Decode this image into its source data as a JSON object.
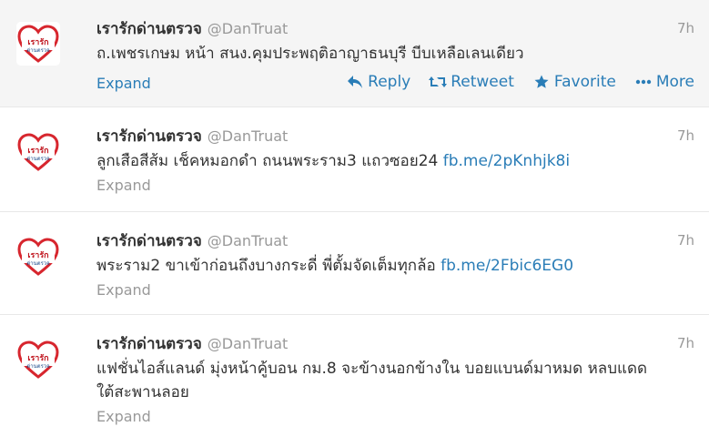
{
  "tweets": [
    {
      "name": "เรารักด่านตรวจ",
      "handle": "@DanTruat",
      "time": "7h",
      "text": "ถ.เพชรเกษม หน้า สนง.คุมประพฤติอาญาธนบุรี บีบเหลือเลนเดียว",
      "link": "",
      "expand": "Expand",
      "actions": [
        "Reply",
        "Retweet",
        "Favorite",
        "More"
      ]
    },
    {
      "name": "เรารักด่านตรวจ",
      "handle": "@DanTruat",
      "time": "7h",
      "text": "ลูกเสือสีส้ม เช็คหมอกดำ ถนนพระราม3 แถวซอย24 ",
      "link": "fb.me/2pKnhjk8i",
      "expand": "Expand"
    },
    {
      "name": "เรารักด่านตรวจ",
      "handle": "@DanTruat",
      "time": "7h",
      "text": "พระราม2 ขาเข้าก่อนถึงบางกระดี่ พี่ตั้มจัดเต็มทุกล้อ ",
      "link": "fb.me/2Fbic6EG0",
      "expand": "Expand"
    },
    {
      "name": "เรารักด่านตรวจ",
      "handle": "@DanTruat",
      "time": "7h",
      "text": "แฟชั่นไอส์แลนด์ มุ่งหน้าคู้บอน กม.8 จะข้างนอกข้างใน บอยแบนด์มาหมด หลบแดดใต้สะพานลอย",
      "link": "",
      "expand": "Expand"
    }
  ],
  "avatar": {
    "heart_color": "#d7262e",
    "label_top": "เรารัก",
    "label_bottom": "ด่านตรวจ"
  },
  "icons": {
    "reply": "reply-arrow-icon",
    "retweet": "retweet-arrows-icon",
    "favorite": "star-icon",
    "more": "dots-icon"
  },
  "colors": {
    "link": "#2a7db7",
    "muted": "#999999",
    "hover_bg": "#f5f5f5"
  }
}
